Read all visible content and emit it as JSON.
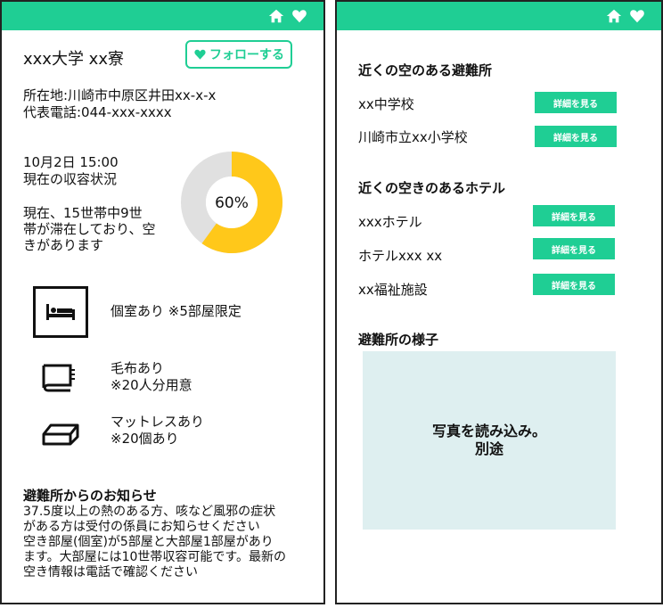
{
  "left": {
    "facility_name": "xxx大学 xx寮",
    "follow_label": "フォローする",
    "address": "所在地:川崎市中原区井田xx-x-x",
    "phone": "代表電話:044-xxx-xxxx",
    "status": {
      "datetime": "10月2日 15:00",
      "label": "現在の収容状況",
      "description_lines": [
        "現在、15世帯中9世",
        "帯が滞在しており、空",
        "きがあります"
      ],
      "percent_text": "60%",
      "occupancy_fraction": 0.6,
      "colors": {
        "filled": "#ffc81a",
        "empty": "#e0e0e0"
      }
    },
    "amenities": [
      {
        "icon": "bed-icon",
        "lines": [
          "個室あり ※5部屋限定"
        ]
      },
      {
        "icon": "blanket-icon",
        "lines": [
          "毛布あり",
          "※20人分用意"
        ]
      },
      {
        "icon": "mattress-icon",
        "lines": [
          "マットレスあり",
          "※20個あり"
        ]
      }
    ],
    "notice": {
      "title": "避難所からのお知らせ",
      "lines": [
        "37.5度以上の熱のある方、咳など風邪の症状",
        "がある方は受付の係員にお知らせください",
        "空き部屋(個室)が5部屋と大部屋1部屋があり",
        "ます。大部屋には10世帯収容可能です。最新の",
        "空き情報は電話で確認ください"
      ]
    }
  },
  "right": {
    "shelters_heading": "近くの空のある避難所",
    "shelters": [
      "xx中学校",
      "川崎市立xx小学校"
    ],
    "hotels_heading": "近くの空きのあるホテル",
    "hotels": [
      "xxxホテル",
      "ホテルxxx xx",
      "xx福祉施設"
    ],
    "details_label": "詳細を見る",
    "photo_heading": "避難所の様子",
    "photo_lines": [
      "写真を読み込み。",
      "別途"
    ]
  },
  "header_icons": [
    "home-icon",
    "heart-icon"
  ],
  "accent_color": "#1fce94"
}
